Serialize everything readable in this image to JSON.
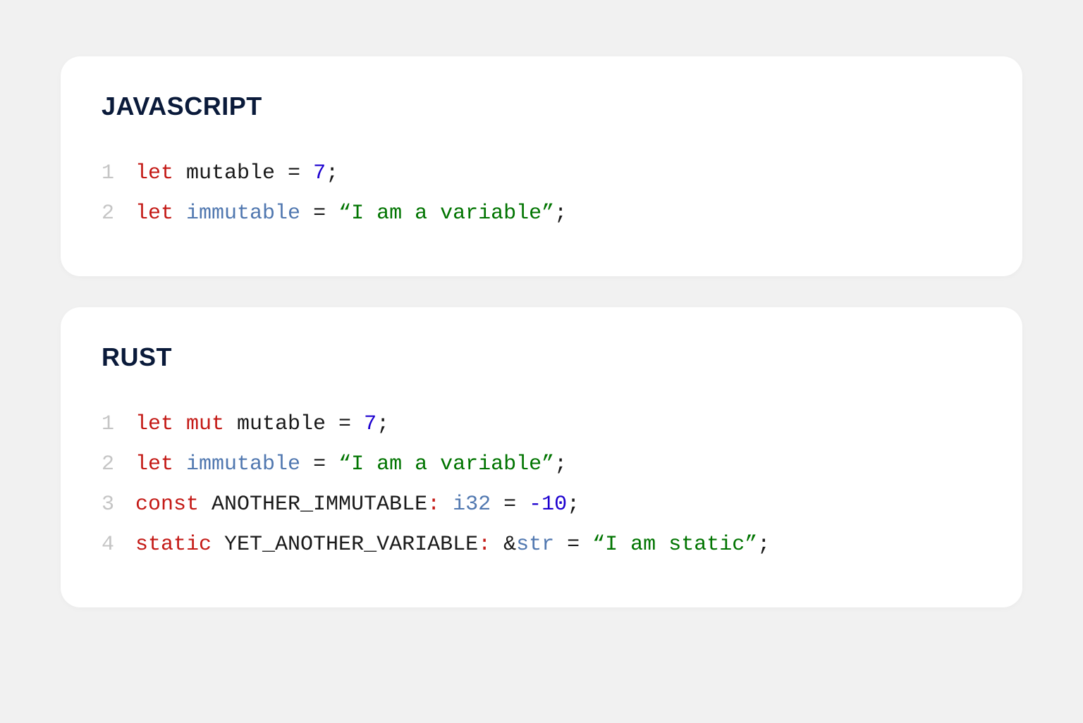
{
  "blocks": [
    {
      "title": "JAVASCRIPT",
      "lines": [
        {
          "num": "1",
          "tokens": [
            {
              "cls": "tok-kw",
              "text": "let"
            },
            {
              "cls": "tok-black",
              "text": " mutable "
            },
            {
              "cls": "tok-black",
              "text": "= "
            },
            {
              "cls": "tok-num",
              "text": "7"
            },
            {
              "cls": "tok-black",
              "text": ";"
            }
          ]
        },
        {
          "num": "2",
          "tokens": [
            {
              "cls": "tok-kw",
              "text": "let"
            },
            {
              "cls": "tok-black",
              "text": " "
            },
            {
              "cls": "tok-ident",
              "text": "immutable"
            },
            {
              "cls": "tok-black",
              "text": " = "
            },
            {
              "cls": "tok-str",
              "text": "“I am a variable”"
            },
            {
              "cls": "tok-black",
              "text": ";"
            }
          ]
        }
      ]
    },
    {
      "title": "RUST",
      "lines": [
        {
          "num": "1",
          "tokens": [
            {
              "cls": "tok-kw",
              "text": "let mut"
            },
            {
              "cls": "tok-black",
              "text": " mutable = "
            },
            {
              "cls": "tok-num",
              "text": "7"
            },
            {
              "cls": "tok-black",
              "text": ";"
            }
          ]
        },
        {
          "num": "2",
          "tokens": [
            {
              "cls": "tok-kw",
              "text": "let"
            },
            {
              "cls": "tok-black",
              "text": " "
            },
            {
              "cls": "tok-ident",
              "text": "immutable"
            },
            {
              "cls": "tok-black",
              "text": " = "
            },
            {
              "cls": "tok-str",
              "text": "“I am a variable”"
            },
            {
              "cls": "tok-black",
              "text": ";"
            }
          ]
        },
        {
          "num": "3",
          "tokens": [
            {
              "cls": "tok-kw",
              "text": "const"
            },
            {
              "cls": "tok-black",
              "text": " ANOTHER_IMMUTABLE"
            },
            {
              "cls": "tok-punct",
              "text": ":"
            },
            {
              "cls": "tok-black",
              "text": " "
            },
            {
              "cls": "tok-type",
              "text": "i32"
            },
            {
              "cls": "tok-black",
              "text": " = "
            },
            {
              "cls": "tok-num",
              "text": "-10"
            },
            {
              "cls": "tok-black",
              "text": ";"
            }
          ]
        },
        {
          "num": "4",
          "tokens": [
            {
              "cls": "tok-kw",
              "text": "static"
            },
            {
              "cls": "tok-black",
              "text": " YET_ANOTHER_VARIABLE"
            },
            {
              "cls": "tok-punct",
              "text": ":"
            },
            {
              "cls": "tok-black",
              "text": " "
            },
            {
              "cls": "tok-amp",
              "text": "&"
            },
            {
              "cls": "tok-type",
              "text": "str"
            },
            {
              "cls": "tok-black",
              "text": " = "
            },
            {
              "cls": "tok-str",
              "text": "“I am static”"
            },
            {
              "cls": "tok-black",
              "text": ";"
            }
          ]
        }
      ]
    }
  ]
}
